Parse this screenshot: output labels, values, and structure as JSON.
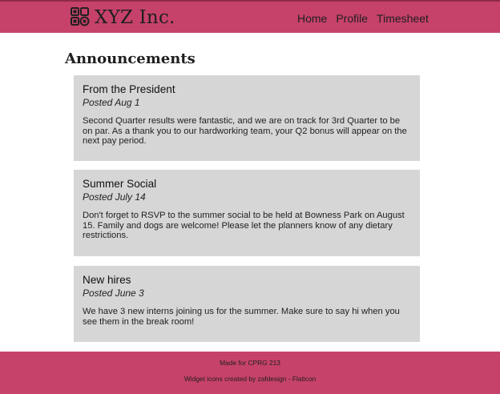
{
  "header": {
    "brand": "XYZ Inc.",
    "logo_icon": "widget-icon",
    "nav": {
      "home": "Home",
      "profile": "Profile",
      "timesheet": "Timesheet"
    },
    "bg_color": "#c6426a"
  },
  "main": {
    "title": "Announcements",
    "announcements": [
      {
        "title": "From the President",
        "date": "Posted Aug 1",
        "body": "Second Quarter results were fantastic, and we are on track for 3rd Quarter to be on par. As a thank you to our hardworking team, your Q2 bonus will appear on the next pay period."
      },
      {
        "title": "Summer Social",
        "date": "Posted July 14",
        "body": "Don't forget to RSVP to the summer social to be held at Bowness Park on August 15. Family and dogs are welcome! Please let the planners know of any dietary restrictions."
      },
      {
        "title": "New hires",
        "date": "Posted June 3",
        "body": "We have 3 new interns joining us for the summer. Make sure to say hi when you see them in the break room!"
      }
    ],
    "card_color": "#d6d6d6"
  },
  "footer": {
    "line1": "Made for CPRG 213",
    "line2": "Widget icons created by zafdesign - Flaticon",
    "bg_color": "#c6426a"
  }
}
